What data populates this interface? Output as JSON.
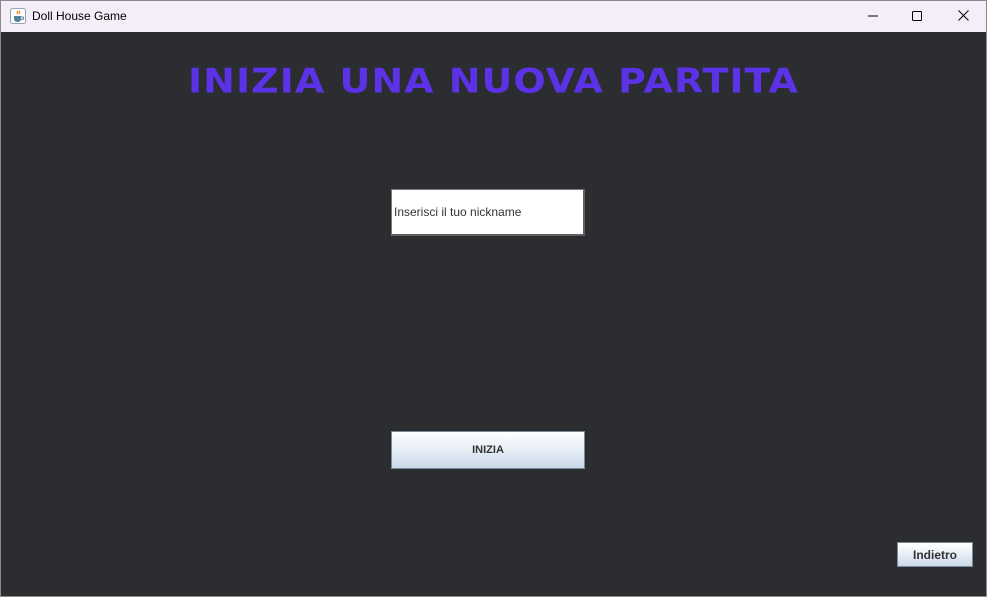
{
  "window": {
    "title": "Doll House Game",
    "app_icon": "java-cup-icon",
    "controls": {
      "minimize_icon": "minimize-icon",
      "maximize_icon": "maximize-icon",
      "close_icon": "close-icon"
    }
  },
  "main": {
    "heading": "INIZIA UNA NUOVA PARTITA",
    "heading_color": "#5b32e6",
    "background_color": "#2b2d30",
    "nickname_field": {
      "value": "",
      "placeholder": "Inserisci il tuo nickname"
    },
    "start_button_label": "INIZIA",
    "back_button_label": "Indietro"
  }
}
